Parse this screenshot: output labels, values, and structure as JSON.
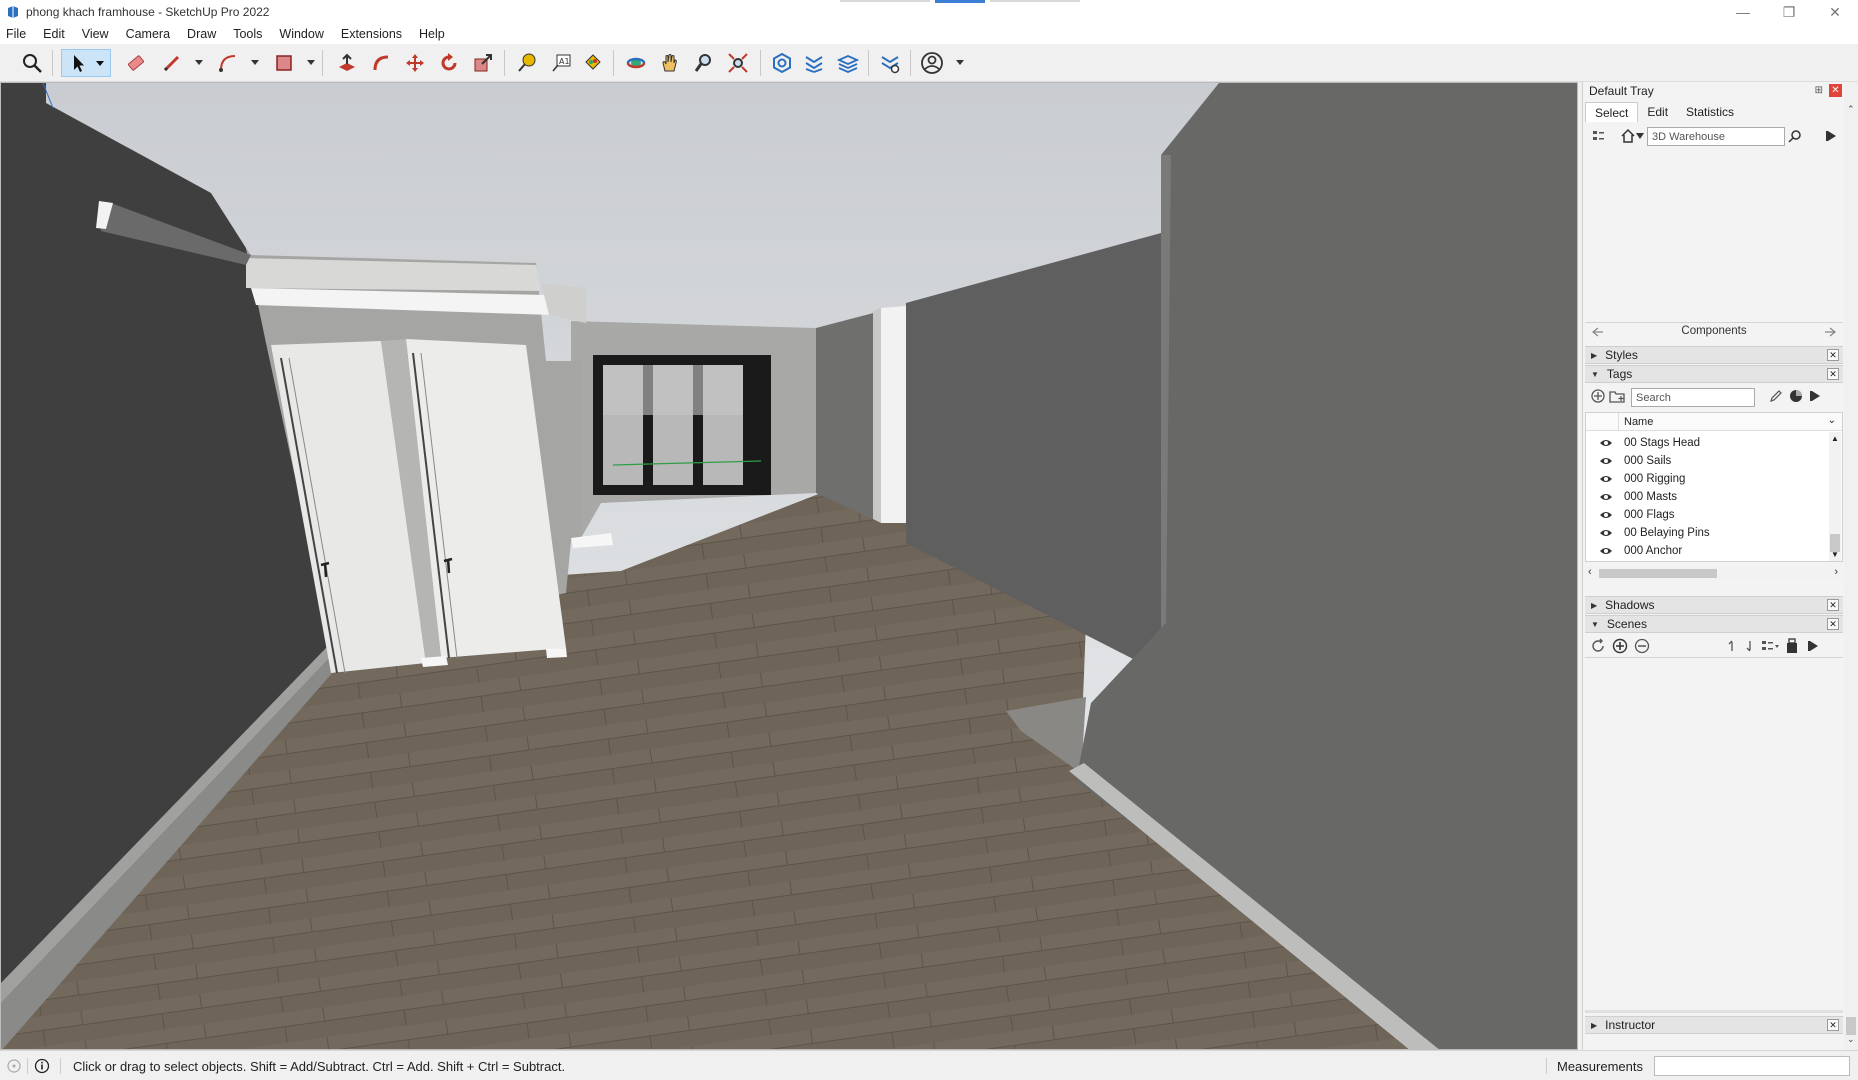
{
  "window": {
    "title": "phong khach framhouse - SketchUp Pro 2022",
    "minimize": "—",
    "maximize": "❐",
    "close": "✕"
  },
  "menu": {
    "items": [
      "File",
      "Edit",
      "View",
      "Camera",
      "Draw",
      "Tools",
      "Window",
      "Extensions",
      "Help"
    ]
  },
  "toolbar": {
    "icons": [
      "search-icon",
      "select-icon",
      "eraser-icon",
      "pencil-icon",
      "arc-icon",
      "rectangle-icon",
      "push-pull-icon",
      "follow-me-icon",
      "move-icon",
      "rotate-icon",
      "scale-icon",
      "tape-measure-icon",
      "text-icon",
      "paint-bucket-icon",
      "orbit-icon",
      "pan-icon",
      "zoom-icon",
      "zoom-extents-icon",
      "warehouse-icon",
      "extension-warehouse-icon",
      "layout-icon",
      "extension-manager-icon",
      "account-icon"
    ]
  },
  "tray": {
    "title": "Default Tray",
    "pin": "⊞",
    "close": "✕",
    "tabs": [
      "Select",
      "Edit",
      "Statistics"
    ],
    "active_tab": "Select",
    "warehouse_placeholder": "3D Warehouse",
    "components_label": "Components",
    "sections": {
      "styles": "Styles",
      "tags": "Tags",
      "shadows": "Shadows",
      "scenes": "Scenes",
      "instructor": "Instructor"
    },
    "tags_search_placeholder": "Search",
    "tags_column": "Name",
    "tag_items": [
      "00 Stags Head",
      "000 Sails",
      "000 Rigging",
      "000 Masts",
      "000 Flags",
      "00 Belaying Pins",
      "000 Anchor"
    ]
  },
  "status": {
    "hint": "Click or drag to select objects. Shift = Add/Subtract. Ctrl = Add. Shift + Ctrl = Subtract.",
    "measurements_label": "Measurements",
    "measurements_value": ""
  },
  "colors": {
    "accent": "#3b7fd6",
    "tool_active_bg": "#cce4f7",
    "close_red": "#e0443a",
    "wall_dark": "#3f3f3f",
    "wall_mid": "#646464",
    "floor": "#6e6458",
    "sky": "#e8eaec"
  }
}
